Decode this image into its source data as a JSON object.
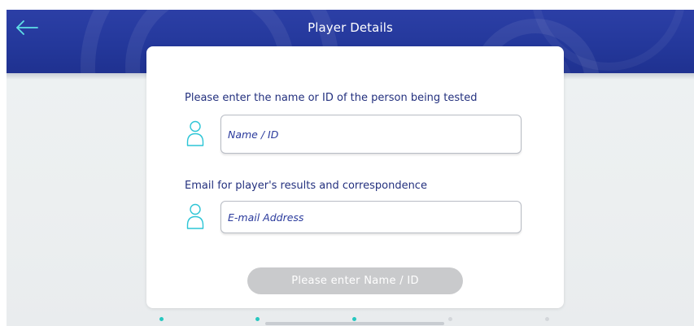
{
  "header": {
    "title": "Player Details",
    "back_icon": "arrow-left-icon",
    "color": "#24389b"
  },
  "form": {
    "name_label": "Please enter the name or ID of the person being tested",
    "name_placeholder": "Name / ID",
    "name_value": "",
    "email_label": "Email for player's results and correspondence",
    "email_placeholder": "E-mail Address",
    "email_value": "",
    "field_icon": "user-icon",
    "icon_color": "#2cc5d6",
    "submit_label": "Please enter Name / ID",
    "submit_enabled": false
  },
  "pagination": {
    "active_color": "#27c7c0",
    "pages": [
      {
        "state": "active"
      },
      {
        "state": "active"
      },
      {
        "state": "active"
      },
      {
        "state": "inactive"
      },
      {
        "state": "inactive"
      }
    ]
  }
}
